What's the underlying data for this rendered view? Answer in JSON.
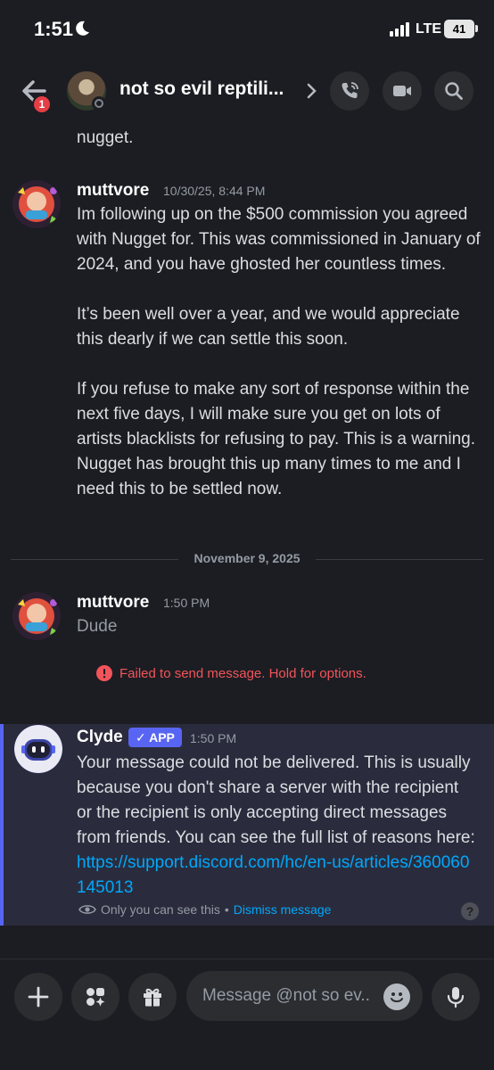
{
  "status_bar": {
    "time": "1:51",
    "network": "LTE",
    "battery": "41"
  },
  "header": {
    "title": "not so evil reptili...",
    "unread_count": "1"
  },
  "messages": {
    "cut_text": "nugget.",
    "msg1": {
      "author": "muttvore",
      "time": "10/30/25, 8:44 PM",
      "paragraphs": [
        "Im following up on the $500 commission you agreed with Nugget for. This was commissioned in January of 2024, and you have ghosted her countless times.",
        "It’s been well over a year, and we would appreciate this dearly if we can settle this soon.",
        "If you refuse to make any sort of response within the next five days, I will make sure you get on lots of artists blacklists for refusing to pay. This is a warning. Nugget has brought this up many times to me and I need this to be settled now."
      ]
    },
    "date_divider": "November 9, 2025",
    "msg2": {
      "author": "muttvore",
      "time": "1:50 PM",
      "text": "Dude"
    },
    "failed_notice": "Failed to send message. Hold for options.",
    "clyde": {
      "author": "Clyde",
      "badge": "APP",
      "time": "1:50 PM",
      "text": "Your message could not be delivered. This is usually because you don't share a server with the recipient or the recipient is only accepting direct messages from friends. You can see the full list of reasons here: ",
      "link": "https://support.discord.com/hc/en-us/articles/360060145013",
      "only_you": "Only you can see this",
      "separator": "•",
      "dismiss": "Dismiss message"
    }
  },
  "composer": {
    "placeholder": "Message @not so ev.."
  },
  "colors": {
    "accent": "#5865f2",
    "link": "#00a8fc",
    "error": "#f2545b",
    "badge_red": "#e53e45"
  }
}
